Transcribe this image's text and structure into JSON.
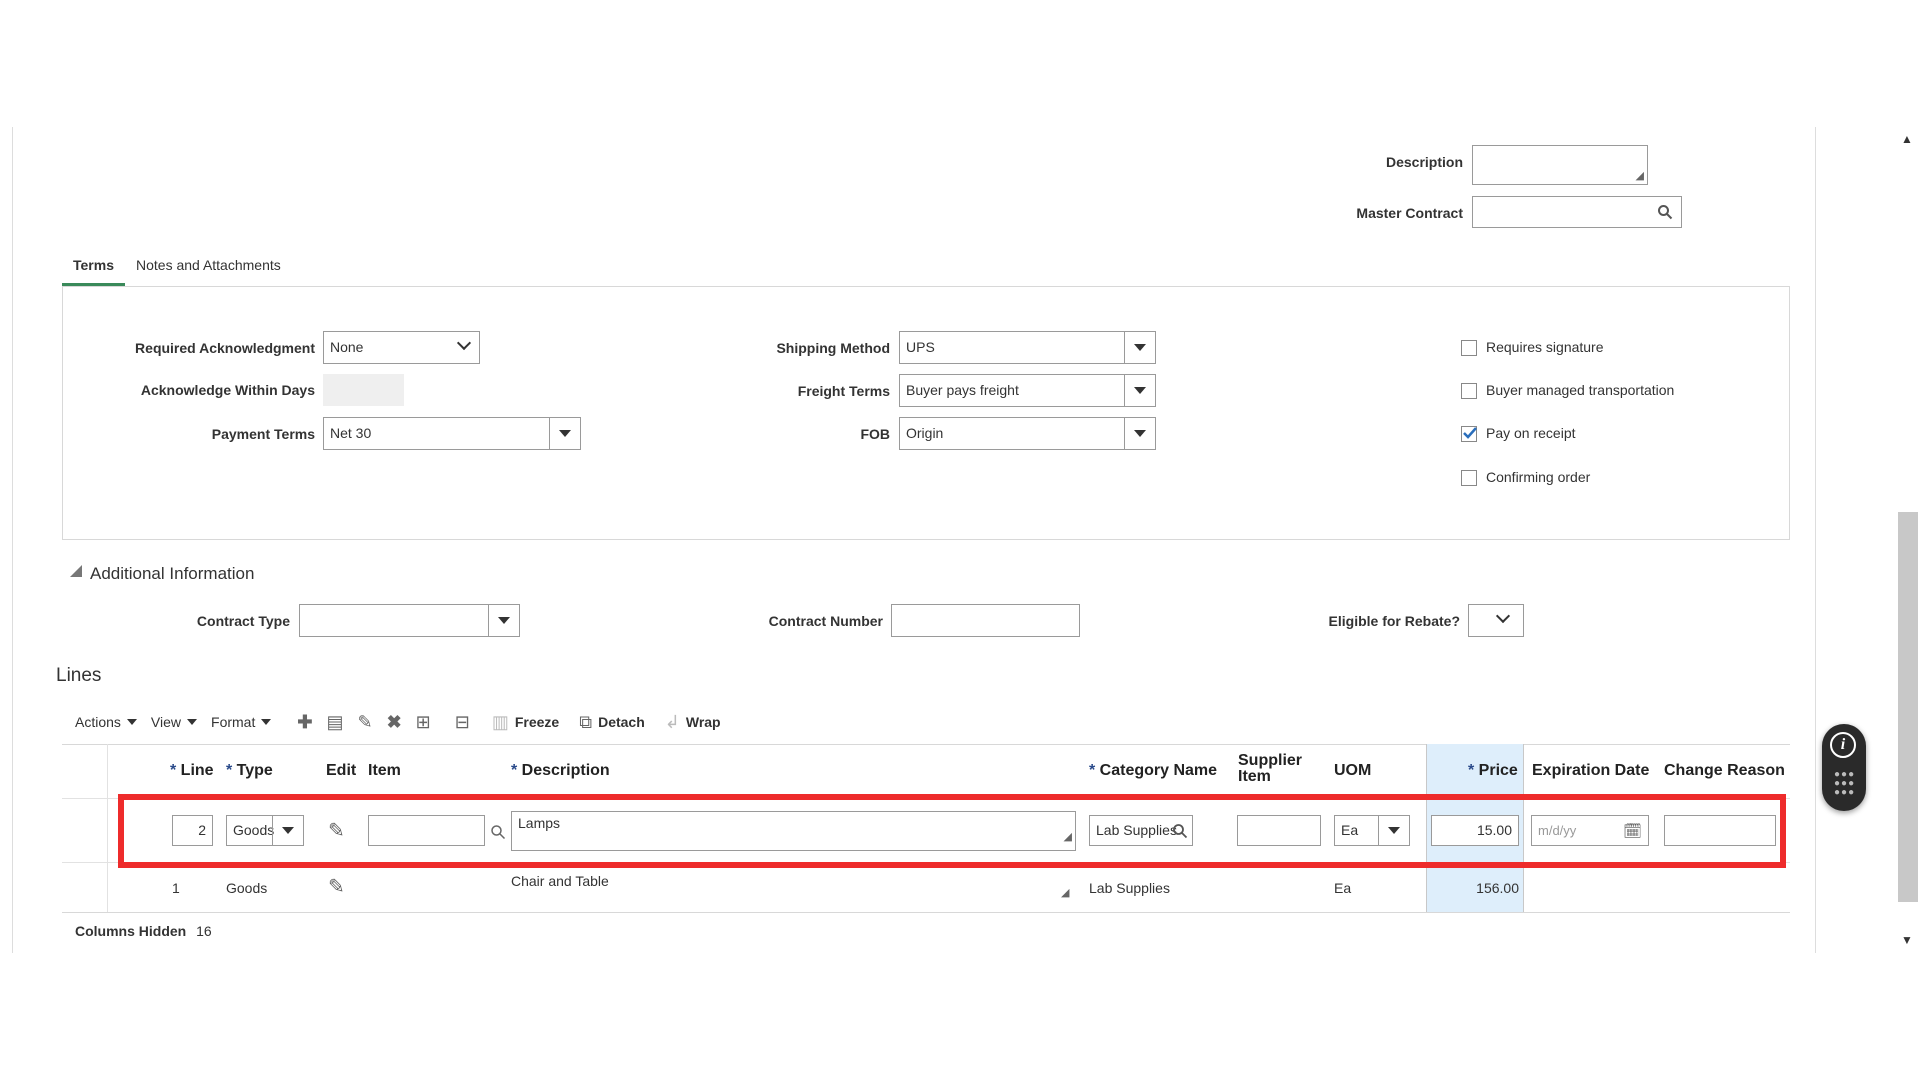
{
  "header": {
    "description_label": "Description",
    "master_contract_label": "Master Contract"
  },
  "tabs": [
    {
      "label": "Terms"
    },
    {
      "label": "Notes and Attachments"
    }
  ],
  "terms": {
    "required_ack_label": "Required Acknowledgment",
    "required_ack_value": "None",
    "ack_within_days_label": "Acknowledge Within Days",
    "payment_terms_label": "Payment Terms",
    "payment_terms_value": "Net 30",
    "shipping_method_label": "Shipping Method",
    "shipping_method_value": "UPS",
    "freight_terms_label": "Freight Terms",
    "freight_terms_value": "Buyer pays freight",
    "fob_label": "FOB",
    "fob_value": "Origin",
    "checkboxes": [
      {
        "label": "Requires signature",
        "checked": false
      },
      {
        "label": "Buyer managed transportation",
        "checked": false
      },
      {
        "label": "Pay on receipt",
        "checked": true
      },
      {
        "label": "Confirming order",
        "checked": false
      }
    ]
  },
  "additional": {
    "section_title": "Additional Information",
    "contract_type_label": "Contract Type",
    "contract_number_label": "Contract Number",
    "eligible_rebate_label": "Eligible for Rebate?"
  },
  "lines": {
    "title": "Lines",
    "toolbar": {
      "actions": "Actions",
      "view": "View",
      "format": "Format",
      "freeze": "Freeze",
      "detach": "Detach",
      "wrap": "Wrap"
    },
    "columns": {
      "line": "Line",
      "type": "Type",
      "edit": "Edit",
      "item": "Item",
      "description": "Description",
      "category_name": "Category Name",
      "supplier_item_1": "Supplier",
      "supplier_item_2": "Item",
      "uom": "UOM",
      "price": "Price",
      "expiration_date": "Expiration Date",
      "change_reason": "Change Reason"
    },
    "edit_row": {
      "line": "2",
      "type": "Goods",
      "description": "Lamps",
      "category": "Lab Supplies",
      "uom": "Ea",
      "price": "15.00",
      "expiration_placeholder": "m/d/yy"
    },
    "row1": {
      "line": "1",
      "type": "Goods",
      "description": "Chair and Table",
      "category": "Lab Supplies",
      "uom": "Ea",
      "price": "156.00"
    },
    "columns_hidden_label": "Columns Hidden",
    "columns_hidden_count": "16"
  },
  "colors": {
    "highlight": "#ee2b2b",
    "price_column_bg": "#deeefb",
    "checkbox_check": "#2a6ebb"
  }
}
